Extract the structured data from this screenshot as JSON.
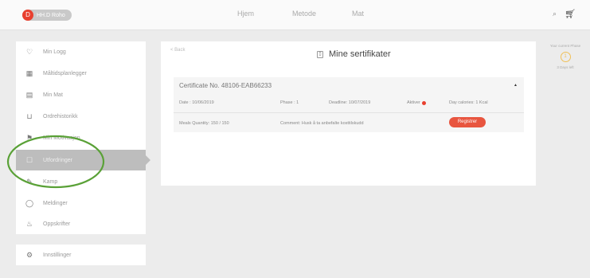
{
  "topbar": {
    "brand_initial": "D",
    "brand_text": "HH.D Roho",
    "nav": [
      "Hjem",
      "Metode",
      "Mat"
    ],
    "search_icon": "search-icon",
    "cart_icon": "cart-icon"
  },
  "sidebar": {
    "items": [
      {
        "label": "Min Logg",
        "icon": "♡"
      },
      {
        "label": "Måltidsplanlegger",
        "icon": "▦"
      },
      {
        "label": "Min Mat",
        "icon": "▤"
      },
      {
        "label": "Ordrehistorikk",
        "icon": "⊔"
      },
      {
        "label": "Min Motivasjon",
        "icon": "⚑"
      },
      {
        "label": "Utfordringer",
        "icon": "☐"
      },
      {
        "label": "Kamp",
        "icon": "✎"
      },
      {
        "label": "Meldinger",
        "icon": "◯"
      },
      {
        "label": "Oppskrifter",
        "icon": "♨"
      }
    ],
    "settings": {
      "label": "Innstillinger",
      "icon": "⚙"
    }
  },
  "main": {
    "back_label": "< Back",
    "title_icon": "▯",
    "title": "Mine sertifikater",
    "certificate": {
      "header": "Certificate No. 48106-EAB66233",
      "date": "Date : 10/06/2019",
      "phase": "Phase : 1",
      "deadline": "Deadline: 10/07/2019",
      "aktiver": "Aktiver",
      "day_calories": "Day calories: 1 Kcal",
      "meals_quantity": "Meals Quantity: 150 / 150",
      "comment": "Comment: Husk å ta anbefalte kosttilskudd",
      "register_label": "Registrer"
    }
  },
  "phase_panel": {
    "label": "Your current Phase",
    "number": "1",
    "days_left": "3 Days left"
  },
  "colors": {
    "accent": "#e8553f",
    "phase": "#f0c056",
    "annotation": "#5aa137"
  }
}
